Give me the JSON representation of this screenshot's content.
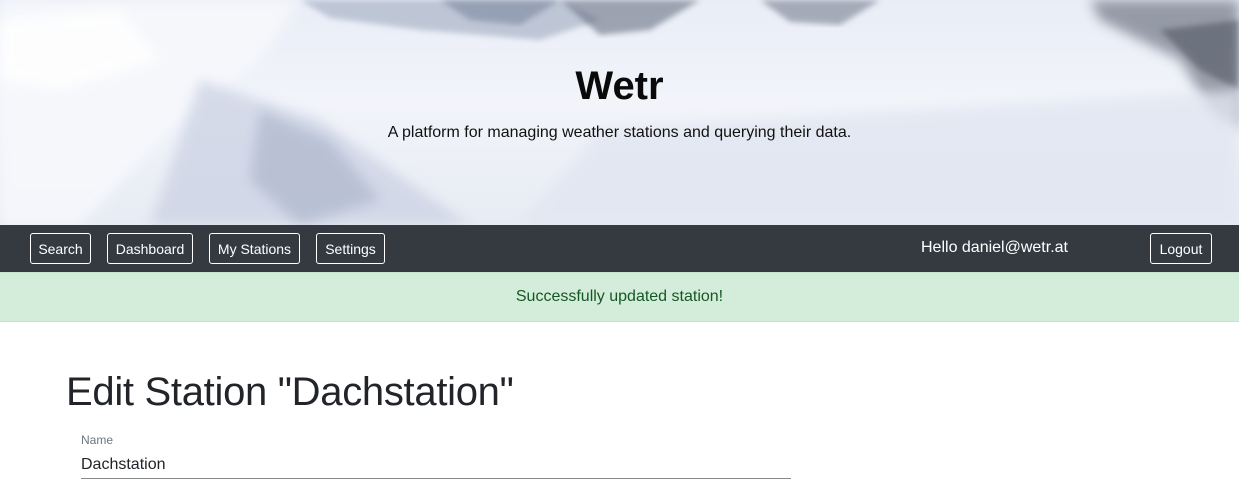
{
  "hero": {
    "title": "Wetr",
    "subtitle": "A platform for managing weather stations and querying their data."
  },
  "navbar": {
    "items": [
      {
        "label": "Search"
      },
      {
        "label": "Dashboard"
      },
      {
        "label": "My Stations"
      },
      {
        "label": "Settings"
      }
    ],
    "greeting": "Hello daniel@wetr.at",
    "logout_label": "Logout",
    "background_color": "#343a40"
  },
  "alert": {
    "message": "Successfully updated station!",
    "background_color": "#d4edda",
    "text_color": "#155724"
  },
  "main": {
    "heading": "Edit Station \"Dachstation\"",
    "name_field": {
      "label": "Name",
      "value": "Dachstation"
    }
  }
}
